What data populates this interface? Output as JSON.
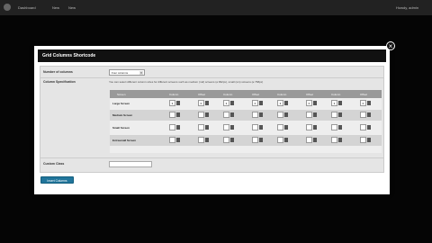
{
  "adminbar": {
    "items": [
      "Dashboard",
      "New",
      "New"
    ],
    "right": "Howdy, admin"
  },
  "modal": {
    "title": "Grid Columns Shortcode",
    "close_label": "×",
    "number_label": "Number of columns",
    "number_value": "Four columns",
    "spec_label": "Column Specification",
    "spec_note": "You can select different column sizes for different screens such as medium (md) screens (≥ 992px), small (sm) screens (≥ 768px)",
    "headers": [
      "Screen",
      "Column",
      "Offset",
      "Column",
      "Offset",
      "Column",
      "Offset",
      "Column",
      "Offset"
    ],
    "rows": [
      {
        "label": "Large Screen",
        "values": [
          "3",
          "0",
          "3",
          "0",
          "3",
          "0",
          "3",
          "0"
        ]
      },
      {
        "label": "Medium Screen",
        "values": [
          "",
          "",
          "",
          "",
          "",
          "",
          "",
          ""
        ]
      },
      {
        "label": "Small Screen",
        "values": [
          "",
          "",
          "",
          "",
          "",
          "",
          "",
          ""
        ]
      },
      {
        "label": "Extrasmall Screen",
        "values": [
          "",
          "",
          "",
          "",
          "",
          "",
          "",
          ""
        ]
      }
    ],
    "custom_label": "Custom Class",
    "custom_value": "",
    "insert_label": "Insert Columns"
  }
}
